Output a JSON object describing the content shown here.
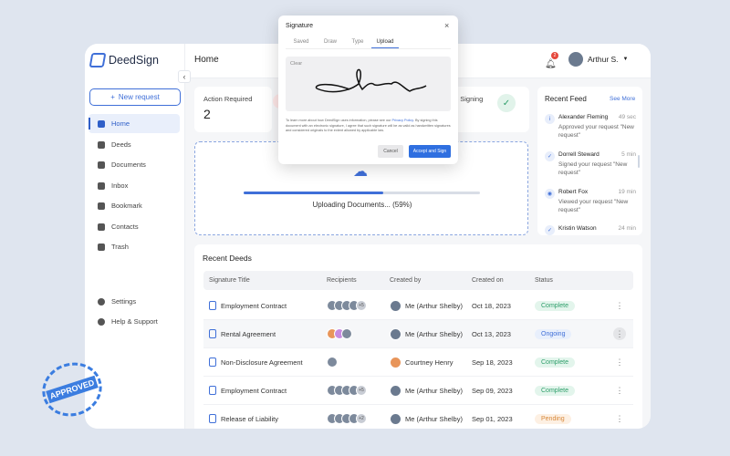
{
  "brand": "DeedSign",
  "sidebar": {
    "new_request": "New request",
    "items": [
      {
        "label": "Home"
      },
      {
        "label": "Deeds"
      },
      {
        "label": "Documents"
      },
      {
        "label": "Inbox"
      },
      {
        "label": "Bookmark"
      },
      {
        "label": "Contacts"
      },
      {
        "label": "Trash"
      }
    ],
    "bottom": [
      {
        "label": "Settings"
      },
      {
        "label": "Help & Support"
      }
    ]
  },
  "header": {
    "title": "Home",
    "notification_count": "2",
    "user": "Arthur S."
  },
  "stats": {
    "action_label": "Action Required",
    "action_value": "2",
    "signing_label": "d Signing"
  },
  "upload": {
    "text": "Uploading Documents... (59%)",
    "progress": 59
  },
  "feed": {
    "title": "Recent Feed",
    "see_more": "See More",
    "items": [
      {
        "name": "Alexander Fleming",
        "time": "49 sec",
        "text": "Approved your request \"New request\""
      },
      {
        "name": "Dorrell Steward",
        "time": "5 min",
        "text": "Signed your request \"New request\""
      },
      {
        "name": "Robert Fox",
        "time": "19 min",
        "text": "Viewed your request \"New request\""
      },
      {
        "name": "Kristin Watson",
        "time": "24 min",
        "text": ""
      }
    ]
  },
  "deeds": {
    "title": "Recent Deeds",
    "columns": [
      "Signature Title",
      "Recipients",
      "Created by",
      "Created on",
      "Status"
    ],
    "rows": [
      {
        "title": "Employment Contract",
        "extra": "+5",
        "creator": "Me (Arthur Shelby)",
        "date": "Oct 18, 2023",
        "status": "Complete"
      },
      {
        "title": "Rental Agreement",
        "extra": "",
        "creator": "Me (Arthur Shelby)",
        "date": "Oct 13, 2023",
        "status": "Ongoing"
      },
      {
        "title": "Non-Disclosure Agreement",
        "extra": "",
        "creator": "Courtney Henry",
        "date": "Sep 18, 2023",
        "status": "Complete"
      },
      {
        "title": "Employment Contract",
        "extra": "+5",
        "creator": "Me (Arthur Shelby)",
        "date": "Sep 09, 2023",
        "status": "Complete"
      },
      {
        "title": "Release of Liability",
        "extra": "+2",
        "creator": "Me (Arthur Shelby)",
        "date": "Sep 01, 2023",
        "status": "Pending"
      }
    ]
  },
  "modal": {
    "title": "Signature",
    "tabs": [
      "Saved",
      "Draw",
      "Type",
      "Upload"
    ],
    "clear": "Clear",
    "legal": "To learn more about how DeedSign uses information, please see our",
    "policy": "Privacy Policy",
    "legal2": ". By signing this document with an electronic signature, I agree that such signature will be as valid as handwritten signatures and considered originals to the extent allowed by applicable law.",
    "cancel": "Cancel",
    "accept": "Accept and Sign"
  },
  "stamp": "APPROVED"
}
